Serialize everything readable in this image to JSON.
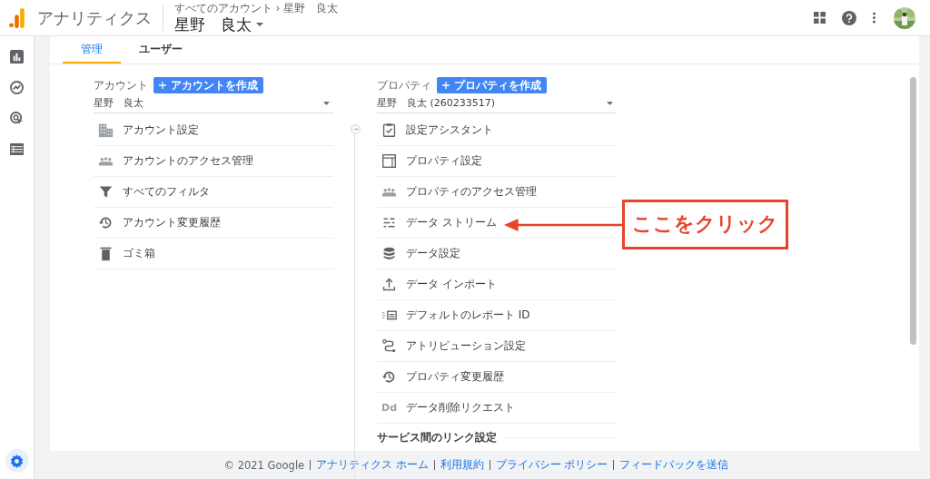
{
  "header": {
    "app_name": "アナリティクス",
    "breadcrumb": "すべてのアカウント › 星野　良太",
    "account_name": "星野　良太"
  },
  "rail": [
    {
      "selected": false
    },
    {
      "selected": false
    },
    {
      "selected": false
    },
    {
      "selected": false
    },
    {
      "selected": true
    }
  ],
  "tabs": [
    {
      "label": "管理",
      "selected": true
    },
    {
      "label": "ユーザー",
      "selected": false
    }
  ],
  "account": {
    "heading": "アカウント",
    "create_button": "アカウントを作成",
    "selector": "星野　良太",
    "items": [
      {
        "label": "アカウント設定"
      },
      {
        "label": "アカウントのアクセス管理"
      },
      {
        "label": "すべてのフィルタ"
      },
      {
        "label": "アカウント変更履歴"
      },
      {
        "label": "ゴミ箱"
      }
    ]
  },
  "property": {
    "heading": "プロパティ",
    "create_button": "プロパティを作成",
    "selector": "星野　良太 (260233517)",
    "items": [
      {
        "label": "設定アシスタント"
      },
      {
        "label": "プロパティ設定"
      },
      {
        "label": "プロパティのアクセス管理"
      },
      {
        "label": "データ ストリーム"
      },
      {
        "label": "データ設定"
      },
      {
        "label": "データ インポート"
      },
      {
        "label": "デフォルトのレポート ID"
      },
      {
        "label": "アトリビューション設定"
      },
      {
        "label": "プロパティ変更履歴"
      },
      {
        "label": "データ削除リクエスト",
        "icon_text": "Dd"
      }
    ],
    "section": "サービス間のリンク設定"
  },
  "callout": {
    "text": "ここをクリック"
  },
  "footer": {
    "copyright": "© 2021 Google",
    "links": [
      "アナリティクス ホーム",
      "利用規約",
      "プライバシー ポリシー",
      "フィードバックを送信"
    ]
  }
}
